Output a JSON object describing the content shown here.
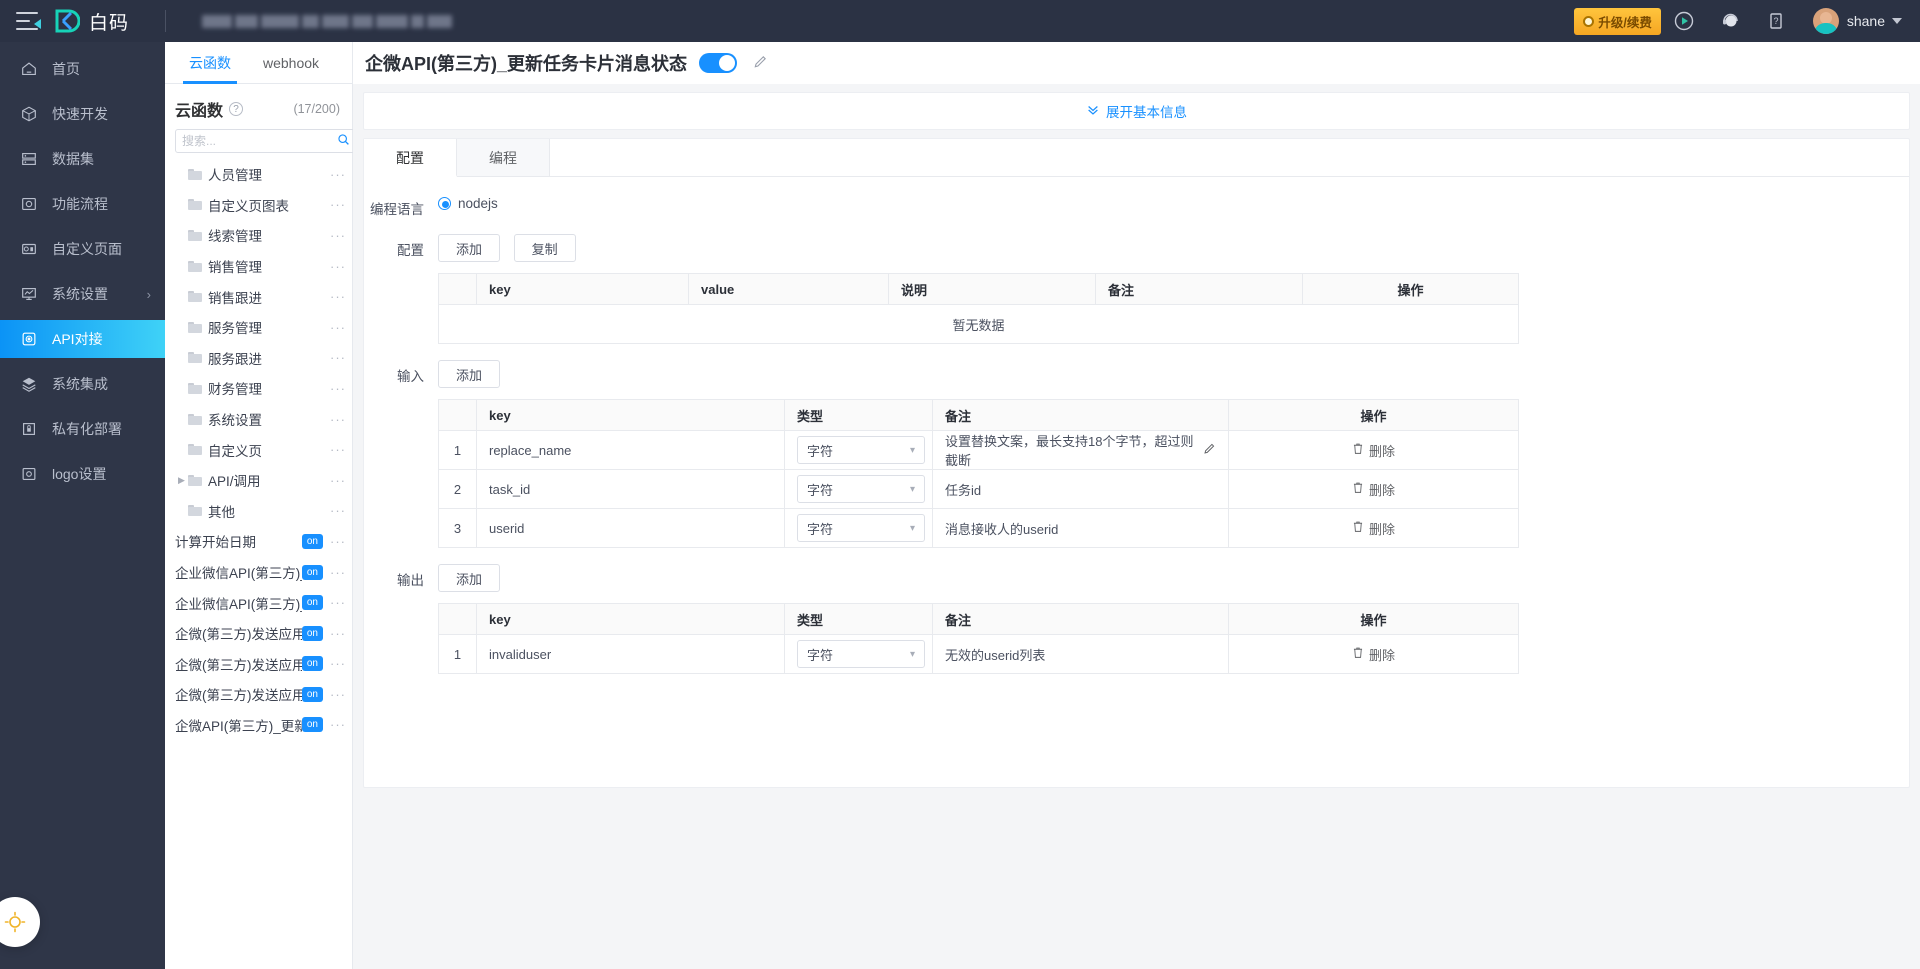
{
  "topbar": {
    "brand": "白码",
    "menu_icon": "hamburger-collapse-icon",
    "upgrade_label": "升级/续费",
    "username": "shane",
    "icons": [
      "play-circle-icon",
      "headset-icon",
      "question-book-icon"
    ]
  },
  "leftnav": {
    "items": [
      {
        "label": "首页",
        "icon": "home-icon",
        "active": false,
        "chevron": ""
      },
      {
        "label": "快速开发",
        "icon": "cube-icon",
        "active": false,
        "chevron": ""
      },
      {
        "label": "数据集",
        "icon": "database-icon",
        "active": false,
        "chevron": ""
      },
      {
        "label": "功能流程",
        "icon": "flow-icon",
        "active": false,
        "chevron": ""
      },
      {
        "label": "自定义页面",
        "icon": "custom-page-icon",
        "active": false,
        "chevron": ""
      },
      {
        "label": "系统设置",
        "icon": "settings-monitor-icon",
        "active": false,
        "chevron": "›"
      },
      {
        "label": "API对接",
        "icon": "api-icon",
        "active": true,
        "chevron": ""
      },
      {
        "label": "系统集成",
        "icon": "layers-icon",
        "active": false,
        "chevron": ""
      },
      {
        "label": "私有化部署",
        "icon": "server-lock-icon",
        "active": false,
        "chevron": ""
      },
      {
        "label": "logo设置",
        "icon": "logo-settings-icon",
        "active": false,
        "chevron": ""
      }
    ]
  },
  "listpanel": {
    "tabs": [
      {
        "label": "云函数",
        "active": true
      },
      {
        "label": "webhook",
        "active": false
      }
    ],
    "title": "云函数",
    "count": "(17/200)",
    "search_placeholder": "搜索...",
    "add_label": "+",
    "tree": [
      {
        "label": "人员管理",
        "type": "folder",
        "arrow": "",
        "badge": "",
        "dots": "···"
      },
      {
        "label": "自定义页图表",
        "type": "folder",
        "arrow": "",
        "badge": "",
        "dots": "···"
      },
      {
        "label": "线索管理",
        "type": "folder",
        "arrow": "",
        "badge": "",
        "dots": "···"
      },
      {
        "label": "销售管理",
        "type": "folder",
        "arrow": "",
        "badge": "",
        "dots": "···"
      },
      {
        "label": "销售跟进",
        "type": "folder",
        "arrow": "",
        "badge": "",
        "dots": "···"
      },
      {
        "label": "服务管理",
        "type": "folder",
        "arrow": "",
        "badge": "",
        "dots": "···"
      },
      {
        "label": "服务跟进",
        "type": "folder",
        "arrow": "",
        "badge": "",
        "dots": "···"
      },
      {
        "label": "财务管理",
        "type": "folder",
        "arrow": "",
        "badge": "",
        "dots": "···"
      },
      {
        "label": "系统设置",
        "type": "folder",
        "arrow": "",
        "badge": "",
        "dots": "···"
      },
      {
        "label": "自定义页",
        "type": "folder",
        "arrow": "",
        "badge": "",
        "dots": "···"
      },
      {
        "label": "API/调用",
        "type": "folder",
        "arrow": "▶",
        "badge": "",
        "dots": "···"
      },
      {
        "label": "其他",
        "type": "folder",
        "arrow": "",
        "badge": "",
        "dots": "···"
      },
      {
        "label": "计算开始日期",
        "type": "func",
        "arrow": "",
        "badge": "on",
        "dots": "···"
      },
      {
        "label": "企业微信API(第三方)_获取",
        "type": "func",
        "arrow": "",
        "badge": "on",
        "dots": "···"
      },
      {
        "label": "企业微信API(第三方)_基础",
        "type": "func",
        "arrow": "",
        "badge": "on",
        "dots": "···"
      },
      {
        "label": "企微(第三方)发送应用消息",
        "type": "func",
        "arrow": "",
        "badge": "on",
        "dots": "···"
      },
      {
        "label": "企微(第三方)发送应用卡片",
        "type": "func",
        "arrow": "",
        "badge": "on",
        "dots": "···"
      },
      {
        "label": "企微(第三方)发送应用任务",
        "type": "func",
        "arrow": "",
        "badge": "on",
        "dots": "···"
      },
      {
        "label": "企微API(第三方)_更新任务",
        "type": "func",
        "arrow": "",
        "badge": "on",
        "dots": "···"
      }
    ]
  },
  "main": {
    "title": "企微API(第三方)_更新任务卡片消息状态",
    "switch_on": true,
    "edit_icon": "pencil-icon",
    "expand_label": "展开基本信息",
    "expand_icon": "chevron-double-down-icon",
    "tabs": [
      {
        "label": "配置",
        "active": true
      },
      {
        "label": "编程",
        "active": false
      }
    ],
    "lang": {
      "label": "编程语言",
      "option": "nodejs"
    },
    "config": {
      "label": "配置",
      "buttons": [
        "添加",
        "复制"
      ],
      "columns": [
        "",
        "key",
        "value",
        "说明",
        "备注",
        "操作"
      ],
      "rows": [],
      "empty_text": "暂无数据"
    },
    "input": {
      "label": "输入",
      "buttons": [
        "添加"
      ],
      "columns": [
        "",
        "key",
        "类型",
        "备注",
        "操作"
      ],
      "rows": [
        {
          "idx": "1",
          "key": "replace_name",
          "type": "字符",
          "remark": "设置替换文案，最长支持18个字节，超过则截断",
          "has_edit": true,
          "action": "删除"
        },
        {
          "idx": "2",
          "key": "task_id",
          "type": "字符",
          "remark": "任务id",
          "has_edit": false,
          "action": "删除"
        },
        {
          "idx": "3",
          "key": "userid",
          "type": "字符",
          "remark": "消息接收人的userid",
          "has_edit": false,
          "action": "删除"
        }
      ]
    },
    "output": {
      "label": "输出",
      "buttons": [
        "添加"
      ],
      "columns": [
        "",
        "key",
        "类型",
        "备注",
        "操作"
      ],
      "rows": [
        {
          "idx": "1",
          "key": "invaliduser",
          "type": "字符",
          "remark": "无效的userid列表",
          "has_edit": false,
          "action": "删除"
        }
      ]
    }
  },
  "colors": {
    "accent": "#1890ff",
    "topbar_bg": "#2b3244",
    "nav_bg": "#2f3648",
    "upgrade": "#f5a623",
    "page_bg": "#f4f5f7"
  }
}
